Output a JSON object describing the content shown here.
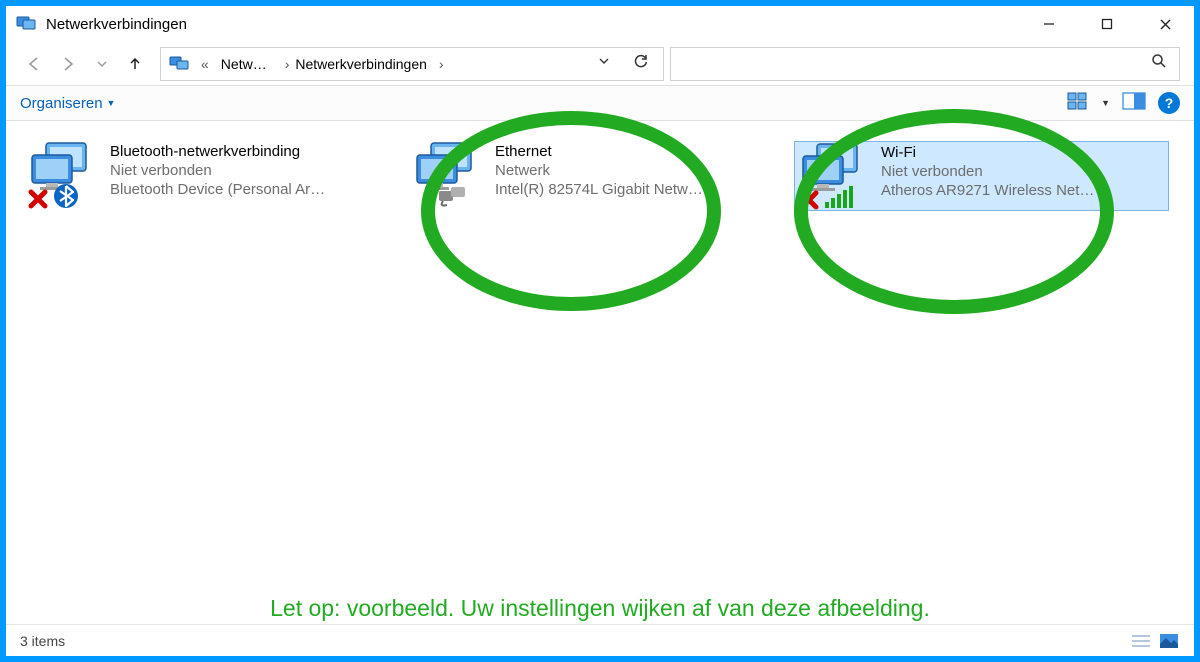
{
  "window": {
    "title": "Netwerkverbindingen"
  },
  "breadcrumb": {
    "prefix": "«",
    "first": "Netw…",
    "second": "Netwerkverbindingen"
  },
  "toolbar": {
    "organize": "Organiseren"
  },
  "connections": [
    {
      "name": "Bluetooth-netwerkverbinding",
      "status": "Niet verbonden",
      "device": "Bluetooth Device (Personal Ar…",
      "disconnected": true,
      "sub": "bluetooth",
      "selected": false
    },
    {
      "name": "Ethernet",
      "status": "Netwerk",
      "device": "Intel(R) 82574L Gigabit Netw…",
      "disconnected": false,
      "sub": "ethernet",
      "selected": false
    },
    {
      "name": "Wi-Fi",
      "status": "Niet verbonden",
      "device": "Atheros AR9271 Wireless Net…",
      "disconnected": true,
      "sub": "wifi",
      "selected": true
    }
  ],
  "statusbar": {
    "count": "3 items"
  },
  "annotation": {
    "text": "Let op: voorbeeld. Uw instellingen wijken af van deze afbeelding."
  }
}
